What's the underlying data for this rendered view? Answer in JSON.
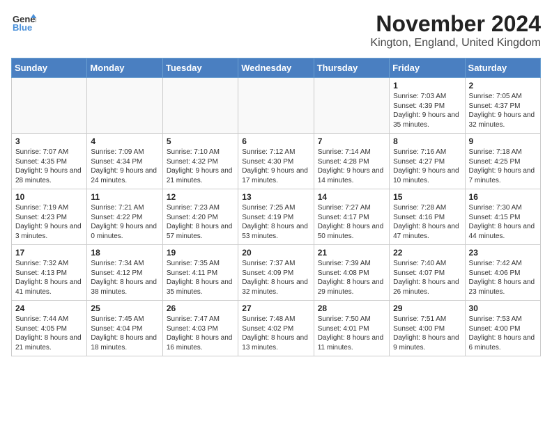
{
  "logo": {
    "general": "General",
    "blue": "Blue"
  },
  "title": "November 2024",
  "location": "Kington, England, United Kingdom",
  "days_of_week": [
    "Sunday",
    "Monday",
    "Tuesday",
    "Wednesday",
    "Thursday",
    "Friday",
    "Saturday"
  ],
  "weeks": [
    [
      {
        "day": "",
        "info": ""
      },
      {
        "day": "",
        "info": ""
      },
      {
        "day": "",
        "info": ""
      },
      {
        "day": "",
        "info": ""
      },
      {
        "day": "",
        "info": ""
      },
      {
        "day": "1",
        "info": "Sunrise: 7:03 AM\nSunset: 4:39 PM\nDaylight: 9 hours and 35 minutes."
      },
      {
        "day": "2",
        "info": "Sunrise: 7:05 AM\nSunset: 4:37 PM\nDaylight: 9 hours and 32 minutes."
      }
    ],
    [
      {
        "day": "3",
        "info": "Sunrise: 7:07 AM\nSunset: 4:35 PM\nDaylight: 9 hours and 28 minutes."
      },
      {
        "day": "4",
        "info": "Sunrise: 7:09 AM\nSunset: 4:34 PM\nDaylight: 9 hours and 24 minutes."
      },
      {
        "day": "5",
        "info": "Sunrise: 7:10 AM\nSunset: 4:32 PM\nDaylight: 9 hours and 21 minutes."
      },
      {
        "day": "6",
        "info": "Sunrise: 7:12 AM\nSunset: 4:30 PM\nDaylight: 9 hours and 17 minutes."
      },
      {
        "day": "7",
        "info": "Sunrise: 7:14 AM\nSunset: 4:28 PM\nDaylight: 9 hours and 14 minutes."
      },
      {
        "day": "8",
        "info": "Sunrise: 7:16 AM\nSunset: 4:27 PM\nDaylight: 9 hours and 10 minutes."
      },
      {
        "day": "9",
        "info": "Sunrise: 7:18 AM\nSunset: 4:25 PM\nDaylight: 9 hours and 7 minutes."
      }
    ],
    [
      {
        "day": "10",
        "info": "Sunrise: 7:19 AM\nSunset: 4:23 PM\nDaylight: 9 hours and 3 minutes."
      },
      {
        "day": "11",
        "info": "Sunrise: 7:21 AM\nSunset: 4:22 PM\nDaylight: 9 hours and 0 minutes."
      },
      {
        "day": "12",
        "info": "Sunrise: 7:23 AM\nSunset: 4:20 PM\nDaylight: 8 hours and 57 minutes."
      },
      {
        "day": "13",
        "info": "Sunrise: 7:25 AM\nSunset: 4:19 PM\nDaylight: 8 hours and 53 minutes."
      },
      {
        "day": "14",
        "info": "Sunrise: 7:27 AM\nSunset: 4:17 PM\nDaylight: 8 hours and 50 minutes."
      },
      {
        "day": "15",
        "info": "Sunrise: 7:28 AM\nSunset: 4:16 PM\nDaylight: 8 hours and 47 minutes."
      },
      {
        "day": "16",
        "info": "Sunrise: 7:30 AM\nSunset: 4:15 PM\nDaylight: 8 hours and 44 minutes."
      }
    ],
    [
      {
        "day": "17",
        "info": "Sunrise: 7:32 AM\nSunset: 4:13 PM\nDaylight: 8 hours and 41 minutes."
      },
      {
        "day": "18",
        "info": "Sunrise: 7:34 AM\nSunset: 4:12 PM\nDaylight: 8 hours and 38 minutes."
      },
      {
        "day": "19",
        "info": "Sunrise: 7:35 AM\nSunset: 4:11 PM\nDaylight: 8 hours and 35 minutes."
      },
      {
        "day": "20",
        "info": "Sunrise: 7:37 AM\nSunset: 4:09 PM\nDaylight: 8 hours and 32 minutes."
      },
      {
        "day": "21",
        "info": "Sunrise: 7:39 AM\nSunset: 4:08 PM\nDaylight: 8 hours and 29 minutes."
      },
      {
        "day": "22",
        "info": "Sunrise: 7:40 AM\nSunset: 4:07 PM\nDaylight: 8 hours and 26 minutes."
      },
      {
        "day": "23",
        "info": "Sunrise: 7:42 AM\nSunset: 4:06 PM\nDaylight: 8 hours and 23 minutes."
      }
    ],
    [
      {
        "day": "24",
        "info": "Sunrise: 7:44 AM\nSunset: 4:05 PM\nDaylight: 8 hours and 21 minutes."
      },
      {
        "day": "25",
        "info": "Sunrise: 7:45 AM\nSunset: 4:04 PM\nDaylight: 8 hours and 18 minutes."
      },
      {
        "day": "26",
        "info": "Sunrise: 7:47 AM\nSunset: 4:03 PM\nDaylight: 8 hours and 16 minutes."
      },
      {
        "day": "27",
        "info": "Sunrise: 7:48 AM\nSunset: 4:02 PM\nDaylight: 8 hours and 13 minutes."
      },
      {
        "day": "28",
        "info": "Sunrise: 7:50 AM\nSunset: 4:01 PM\nDaylight: 8 hours and 11 minutes."
      },
      {
        "day": "29",
        "info": "Sunrise: 7:51 AM\nSunset: 4:00 PM\nDaylight: 8 hours and 9 minutes."
      },
      {
        "day": "30",
        "info": "Sunrise: 7:53 AM\nSunset: 4:00 PM\nDaylight: 8 hours and 6 minutes."
      }
    ]
  ]
}
